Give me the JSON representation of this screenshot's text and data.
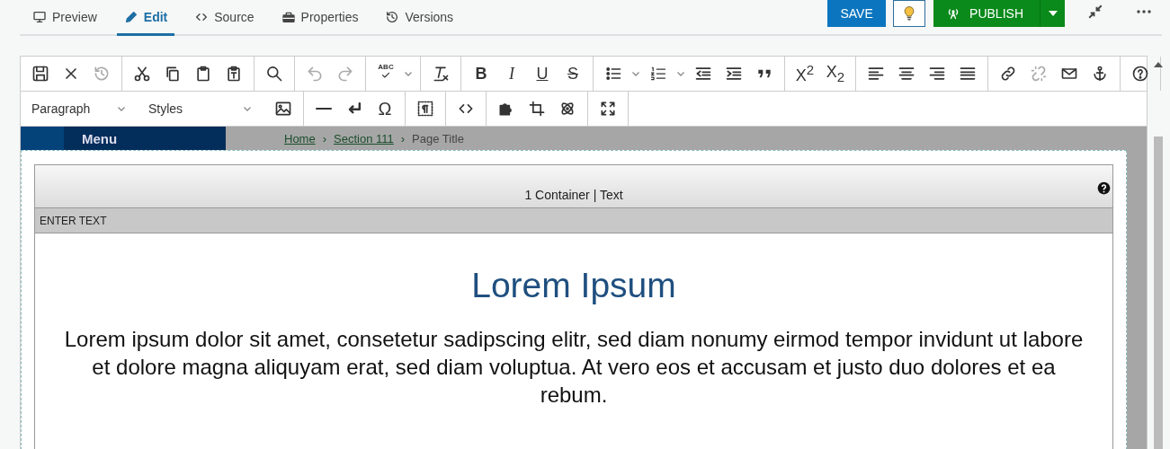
{
  "tabs": [
    {
      "label": "Preview",
      "kind": "preview",
      "selected": false
    },
    {
      "label": "Edit",
      "kind": "edit",
      "selected": true
    },
    {
      "label": "Source",
      "kind": "source",
      "selected": false
    },
    {
      "label": "Properties",
      "kind": "properties",
      "selected": false
    },
    {
      "label": "Versions",
      "kind": "versions",
      "selected": false
    }
  ],
  "actions": {
    "save": "SAVE",
    "publish": "PUBLISH"
  },
  "toolbar": {
    "row_1": [
      [
        {
          "kind": "save",
          "disabled": false,
          "dropdown": false
        },
        {
          "kind": "close",
          "disabled": false,
          "dropdown": false
        },
        {
          "kind": "history",
          "disabled": true,
          "dropdown": false
        }
      ],
      [
        {
          "kind": "cut",
          "disabled": false,
          "dropdown": false
        },
        {
          "kind": "copy",
          "disabled": false,
          "dropdown": false
        },
        {
          "kind": "paste",
          "disabled": false,
          "dropdown": false
        },
        {
          "kind": "paste-text",
          "disabled": false,
          "dropdown": false
        }
      ],
      [
        {
          "kind": "search",
          "disabled": false,
          "dropdown": false
        }
      ],
      [
        {
          "kind": "undo",
          "disabled": true,
          "dropdown": false
        },
        {
          "kind": "redo",
          "disabled": true,
          "dropdown": false
        }
      ],
      [
        {
          "kind": "spellcheck",
          "glyph": "ABC",
          "disabled": false,
          "dropdown": true
        }
      ],
      [
        {
          "kind": "clear-format",
          "disabled": false,
          "dropdown": false
        }
      ],
      [
        {
          "kind": "bold",
          "glyph": "B",
          "disabled": false,
          "dropdown": false
        },
        {
          "kind": "italic",
          "glyph": "I",
          "disabled": false,
          "dropdown": false
        },
        {
          "kind": "underline",
          "glyph": "U",
          "disabled": false,
          "dropdown": false
        },
        {
          "kind": "strike",
          "glyph": "S",
          "disabled": false,
          "dropdown": false
        }
      ],
      [
        {
          "kind": "bullet-list",
          "disabled": false,
          "dropdown": true
        },
        {
          "kind": "numbered-list",
          "disabled": false,
          "dropdown": true
        },
        {
          "kind": "outdent",
          "disabled": false,
          "dropdown": false
        },
        {
          "kind": "indent",
          "disabled": false,
          "dropdown": false
        },
        {
          "kind": "quote",
          "disabled": false,
          "dropdown": false
        }
      ],
      [
        {
          "kind": "superscript",
          "glyph": "X$^{2}$",
          "disabled": false,
          "dropdown": false
        },
        {
          "kind": "subscript",
          "glyph": "X$_{2}$",
          "disabled": false,
          "dropdown": false
        }
      ],
      [
        {
          "kind": "align-left",
          "disabled": false,
          "dropdown": false
        },
        {
          "kind": "align-center",
          "disabled": false,
          "dropdown": false
        },
        {
          "kind": "align-right",
          "disabled": false,
          "dropdown": false
        },
        {
          "kind": "justify",
          "disabled": false,
          "dropdown": false
        }
      ],
      [
        {
          "kind": "link",
          "disabled": false,
          "dropdown": false
        },
        {
          "kind": "unlink",
          "disabled": true,
          "dropdown": false
        },
        {
          "kind": "email",
          "disabled": false,
          "dropdown": false
        },
        {
          "kind": "anchor",
          "disabled": false,
          "dropdown": false
        }
      ],
      [
        {
          "kind": "help",
          "disabled": false,
          "dropdown": false
        }
      ]
    ],
    "selects": [
      {
        "label": "Paragraph"
      },
      {
        "label": "Styles"
      }
    ],
    "row_2": [
      [
        {
          "kind": "image",
          "disabled": false,
          "dropdown": false
        }
      ],
      [
        {
          "kind": "hr",
          "disabled": false,
          "dropdown": false
        },
        {
          "kind": "enter",
          "disabled": false,
          "dropdown": false
        },
        {
          "kind": "symbol",
          "glyph": "Ω",
          "disabled": false,
          "dropdown": false
        }
      ],
      [
        {
          "kind": "show-blocks",
          "disabled": false,
          "dropdown": false
        }
      ],
      [
        {
          "kind": "code",
          "disabled": false,
          "dropdown": false
        }
      ],
      [
        {
          "kind": "puzzle",
          "disabled": false,
          "dropdown": false
        },
        {
          "kind": "crop",
          "disabled": false,
          "dropdown": false
        },
        {
          "kind": "atom",
          "disabled": false,
          "dropdown": false
        }
      ],
      [
        {
          "kind": "maximize",
          "disabled": false,
          "dropdown": false
        }
      ]
    ]
  },
  "page_header": {
    "menu": "Menu",
    "breadcrumb": [
      {
        "label": "Home",
        "kind": "link"
      },
      {
        "label": "Section 111",
        "kind": "link",
        "prefix": "›"
      },
      {
        "label": "Page Title",
        "kind": "current",
        "prefix": "›"
      }
    ]
  },
  "component": {
    "title": "1 Container | Text",
    "label": "ENTER TEXT",
    "heading": "Lorem Ipsum",
    "paragraph": "Lorem ipsum dolor sit amet, consetetur sadipscing elitr, sed diam nonumy eirmod tempor invidunt ut labore et dolore magna aliquyam erat, sed diam voluptua. At vero eos et accusam et justo duo dolores et ea rebum."
  }
}
